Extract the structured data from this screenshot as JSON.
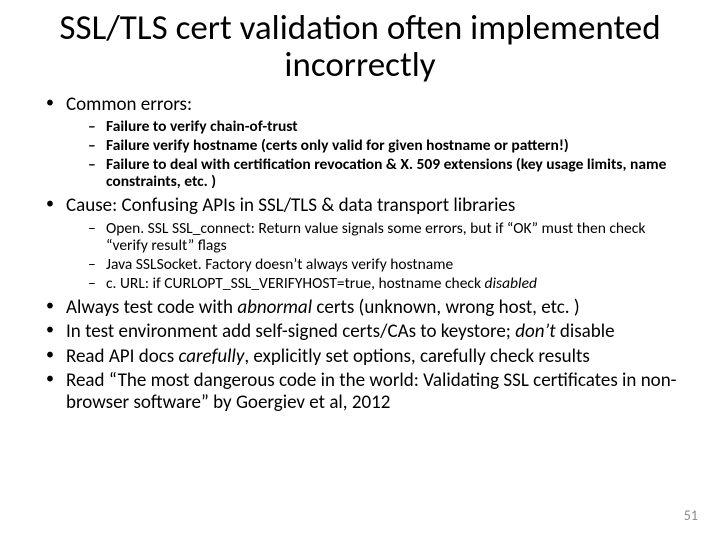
{
  "title": "SSL/TLS cert validation often implemented incorrectly",
  "bullets": {
    "b1": "Common errors:",
    "b1s1": "Failure to verify chain-of-trust",
    "b1s2": "Failure verify hostname (certs only valid for given hostname or pattern!)",
    "b1s3": "Failure to deal with certification revocation & X. 509 extensions (key usage limits, name constraints, etc. )",
    "b2": "Cause: Confusing APIs in SSL/TLS & data transport libraries",
    "b2s1": "Open. SSL SSL_connect: Return value signals some errors, but if “OK” must then check “verify result” flags",
    "b2s2": "Java SSLSocket. Factory doesn’t always verify hostname",
    "b2s3_a": "c. URL: if CURLOPT_SSL_VERIFYHOST=true, hostname check ",
    "b2s3_b": "disabled",
    "b3_a": "Always test code with ",
    "b3_b": "abnormal",
    "b3_c": " certs (unknown, wrong host, etc. )",
    "b4_a": "In test environment add self-signed certs/CAs to keystore; ",
    "b4_b": "don’t",
    "b4_c": " disable",
    "b5_a": "Read API docs ",
    "b5_b": "carefully",
    "b5_c": ", explicitly set options, carefully check results",
    "b6": "Read “The most dangerous code in the world: Validating SSL certificates in non-browser software” by Goergiev et al, 2012"
  },
  "page_number": "51"
}
